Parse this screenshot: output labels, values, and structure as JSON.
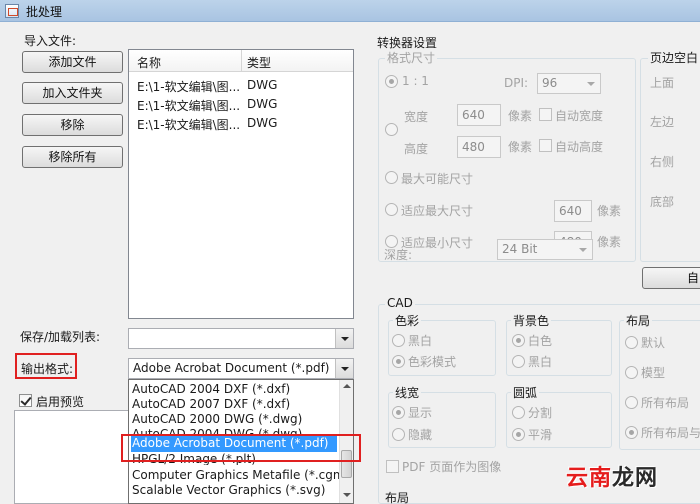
{
  "window": {
    "title": "批处理"
  },
  "import": {
    "title": "导入文件:",
    "buttons": {
      "add_file": "添加文件",
      "add_folder": "加入文件夹",
      "remove": "移除",
      "remove_all": "移除所有"
    },
    "columns": {
      "name": "名称",
      "type": "类型"
    },
    "files": [
      {
        "name": "E:\\1-软文编辑\\图...",
        "type": "DWG"
      },
      {
        "name": "E:\\1-软文编辑\\图...",
        "type": "DWG"
      },
      {
        "name": "E:\\1-软文编辑\\图...",
        "type": "DWG"
      }
    ]
  },
  "save_load": {
    "label": "保存/加载列表:",
    "value": ""
  },
  "output": {
    "label": "输出格式:",
    "value": "Adobe Acrobat Document (*.pdf)",
    "options": [
      "AutoCAD 2004 DXF (*.dxf)",
      "AutoCAD 2007 DXF (*.dxf)",
      "AutoCAD 2000 DWG (*.dwg)",
      "AutoCAD 2004 DWG (*.dwg)",
      "Adobe Acrobat Document (*.pdf)",
      "HPGL/2 Image (*.plt)",
      "Computer Graphics Metafile (*.cgm)",
      "Scalable Vector Graphics (*.svg)"
    ],
    "selected_index": 4
  },
  "preview": {
    "label": "启用预览",
    "checked": true
  },
  "converter": {
    "title": "转换器设置",
    "format_size": {
      "title": "格式尺寸",
      "ratio_label": "1 : 1",
      "dpi_label": "DPI:",
      "dpi_value": "96",
      "width_label": "宽度",
      "width_value": "640",
      "height_label": "高度",
      "height_value": "480",
      "unit": "像素",
      "auto_width": "自动宽度",
      "auto_height": "自动高度",
      "max_possible": "最大可能尺寸",
      "fit_max": "适应最大尺寸",
      "fit_max_value": "640",
      "fit_min": "适应最小尺寸",
      "fit_min_value": "480",
      "depth_label": "深度:",
      "depth_value": "24 Bit"
    },
    "margins": {
      "title": "页边空白",
      "top": "上面",
      "left": "左边",
      "right": "右侧",
      "bottom": "底部",
      "button_label": "自"
    },
    "cad": {
      "title": "CAD",
      "color": {
        "title": "色彩",
        "bw": "黑白",
        "color_mode": "色彩模式"
      },
      "background": {
        "title": "背景色",
        "white": "白色",
        "black": "黑白"
      },
      "layout": {
        "title": "布局",
        "default": "默认",
        "model": "模型",
        "all_layouts": "所有布局",
        "all_layouts_and": "所有布局与"
      },
      "lineweight": {
        "title": "线宽",
        "show": "显示",
        "hide": "隐藏"
      },
      "arc": {
        "title": "圆弧",
        "split": "分割",
        "smooth": "平滑"
      },
      "pdf_as_image": "PDF 页面作为图像",
      "layout2": "布局"
    }
  },
  "watermark": {
    "text1": "云南",
    "text2": "龙网"
  }
}
